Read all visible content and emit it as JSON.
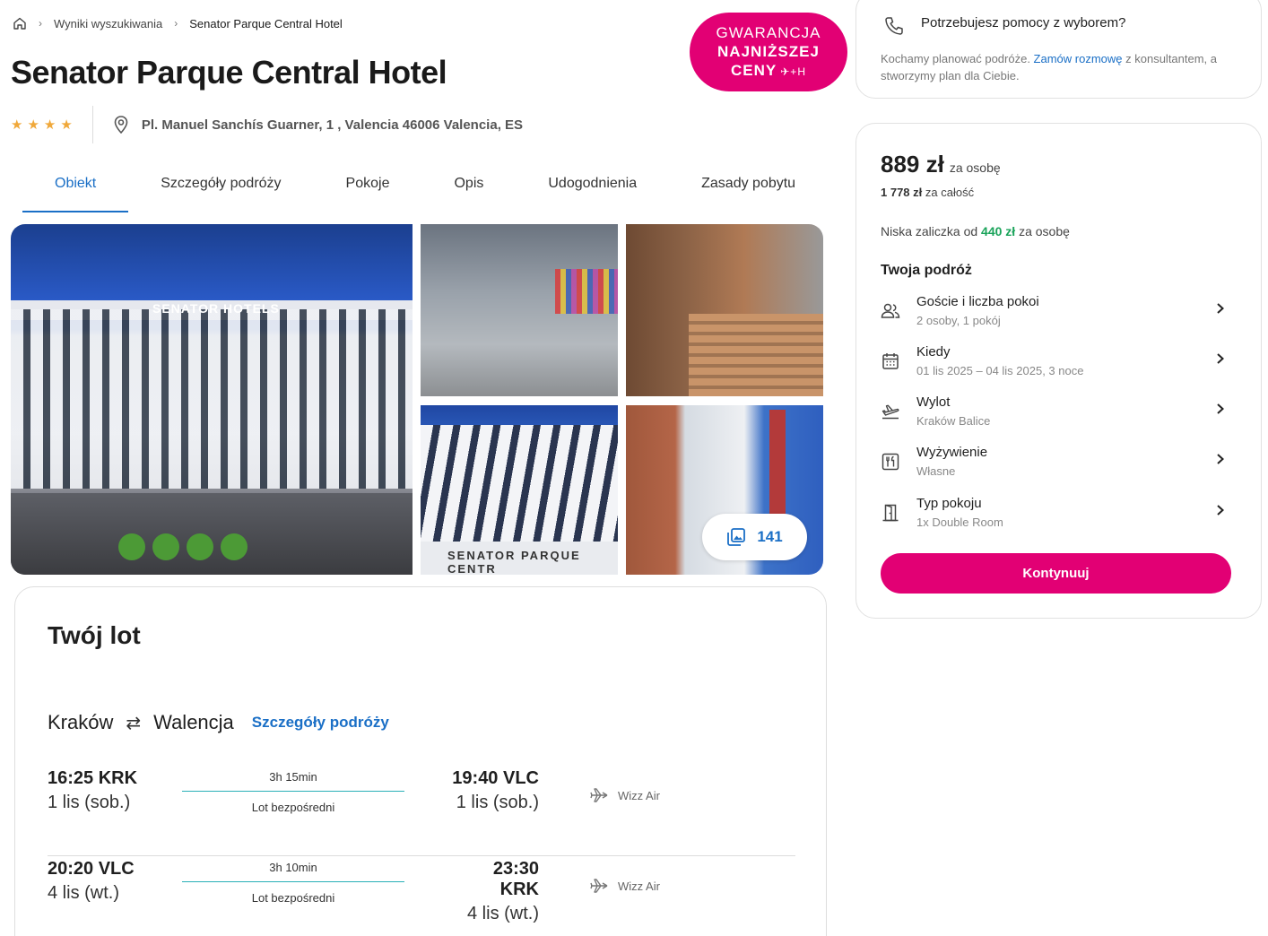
{
  "breadcrumb": {
    "items": [
      "Wyniki wyszukiwania",
      "Senator Parque Central Hotel"
    ]
  },
  "hotel": {
    "name": "Senator Parque Central Hotel",
    "stars": 4,
    "address": "Pl. Manuel Sanchís Guarner, 1 , Valencia 46006 Valencia, ES"
  },
  "badge": {
    "line1": "GWARANCJA",
    "line2": "NAJNIŻSZEJ",
    "line3": "CENY",
    "icons": "✈+H"
  },
  "tabs": [
    "Obiekt",
    "Szczegóły podróży",
    "Pokoje",
    "Opis",
    "Udogodnienia",
    "Zasady pobytu"
  ],
  "gallery": {
    "photo_count": "141",
    "main_sign": "SENATOR HOTELS",
    "facade_letters": "SENATOR PARQUE CENTR"
  },
  "flight": {
    "title": "Twój lot",
    "from": "Kraków",
    "to": "Walencja",
    "details_link": "Szczegóły podróży",
    "legs": [
      {
        "dep_time": "16:25 KRK",
        "dep_date": "1 lis (sob.)",
        "duration": "3h 15min",
        "type": "Lot bezpośredni",
        "arr_time": "19:40 VLC",
        "arr_date": "1 lis (sob.)",
        "airline": "Wizz Air"
      },
      {
        "dep_time": "20:20 VLC",
        "dep_date": "4 lis (wt.)",
        "duration": "3h 10min",
        "type": "Lot bezpośredni",
        "arr_time": "23:30 KRK",
        "arr_date": "4 lis (wt.)",
        "airline": "Wizz Air"
      }
    ]
  },
  "help": {
    "title": "Potrzebujesz pomocy z wyborem?",
    "text_before": "Kochamy planować podróże. ",
    "link": "Zamów rozmowę",
    "text_after": " z konsultantem, a stworzymy plan dla Ciebie."
  },
  "price": {
    "amount": "889 zł",
    "per": "za osobę",
    "total_amount": "1 778 zł",
    "total_label": "za całość",
    "deposit_label": "Niska zaliczka od",
    "deposit_amount": "440 zł",
    "deposit_suffix": "za osobę"
  },
  "trip": {
    "title": "Twoja podróż",
    "rows": [
      {
        "label": "Goście i liczba pokoi",
        "value": "2 osoby, 1 pokój",
        "icon": "guests-icon"
      },
      {
        "label": "Kiedy",
        "value": "01 lis 2025 – 04 lis 2025, 3 noce",
        "icon": "calendar-icon"
      },
      {
        "label": "Wylot",
        "value": "Kraków Balice",
        "icon": "departure-icon"
      },
      {
        "label": "Wyżywienie",
        "value": "Własne",
        "icon": "meal-icon"
      },
      {
        "label": "Typ pokoju",
        "value": "1x Double Room",
        "icon": "door-icon"
      }
    ],
    "continue_label": "Kontynuuj"
  },
  "colors": {
    "accent_pink": "#e20074",
    "link_blue": "#1a6fc6",
    "deposit_green": "#1aa35a",
    "star": "#f0a83a"
  }
}
